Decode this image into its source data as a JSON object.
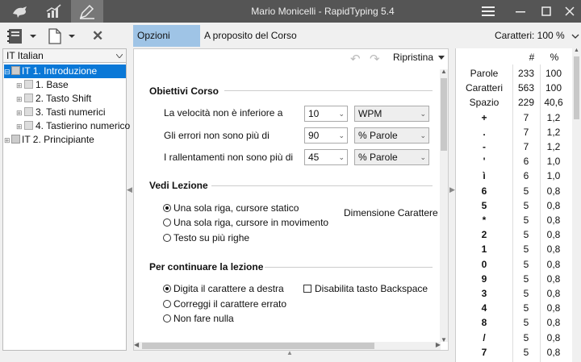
{
  "window": {
    "title": "Mario Monicelli - RapidTyping 5.4"
  },
  "toolbar": {
    "close_glyph": "✕"
  },
  "tabs": [
    {
      "label": "Opzioni Corso"
    },
    {
      "label": "A proposito del Corso"
    }
  ],
  "font_size_control": {
    "label": "Caratteri: 100 %"
  },
  "course_selector": {
    "value": "IT Italian"
  },
  "tree": [
    {
      "label": "IT 1. Introduzione",
      "selected": true
    },
    {
      "label": "1. Base"
    },
    {
      "label": "2. Tasto Shift"
    },
    {
      "label": "3. Tasti numerici"
    },
    {
      "label": "4. Tastierino numerico"
    },
    {
      "label": "IT 2. Principiante"
    }
  ],
  "panel": {
    "restore_label": "Ripristina"
  },
  "objectives": {
    "heading": "Obiettivi Corso",
    "rows": [
      {
        "label": "La velocità non è inferiore a",
        "value": "10",
        "unit": "WPM"
      },
      {
        "label": "Gli errori non sono più di",
        "value": "90",
        "unit": "% Parole"
      },
      {
        "label": "I rallentamenti non sono più di",
        "value": "45",
        "unit": "% Parole"
      }
    ]
  },
  "view": {
    "heading": "Vedi Lezione",
    "options": [
      "Una sola riga, cursore statico",
      "Una sola riga, cursore in movimento",
      "Testo su più righe"
    ],
    "font_size_label": "Dimensione Carattere"
  },
  "continue": {
    "heading": "Per continuare la lezione",
    "options": [
      "Digita il carattere a destra",
      "Correggi il carattere errato",
      "Non fare nulla"
    ],
    "checkbox_label": "Disabilita tasto Backspace"
  },
  "stats": {
    "headers": [
      "#",
      "%"
    ],
    "rows": [
      [
        "Parole",
        "233",
        "100"
      ],
      [
        "Caratteri",
        "563",
        "100"
      ],
      [
        "Spazio",
        "229",
        "40,6"
      ],
      [
        "+",
        "7",
        "1,2"
      ],
      [
        ".",
        "7",
        "1,2"
      ],
      [
        "-",
        "7",
        "1,2"
      ],
      [
        "'",
        "6",
        "1,0"
      ],
      [
        "ì",
        "6",
        "1,0"
      ],
      [
        "6",
        "5",
        "0,8"
      ],
      [
        "5",
        "5",
        "0,8"
      ],
      [
        "*",
        "5",
        "0,8"
      ],
      [
        "2",
        "5",
        "0,8"
      ],
      [
        "1",
        "5",
        "0,8"
      ],
      [
        "0",
        "5",
        "0,8"
      ],
      [
        "9",
        "5",
        "0,8"
      ],
      [
        "3",
        "5",
        "0,8"
      ],
      [
        "4",
        "5",
        "0,8"
      ],
      [
        "8",
        "5",
        "0,8"
      ],
      [
        "/",
        "5",
        "0,8"
      ],
      [
        "7",
        "5",
        "0,8"
      ]
    ]
  }
}
